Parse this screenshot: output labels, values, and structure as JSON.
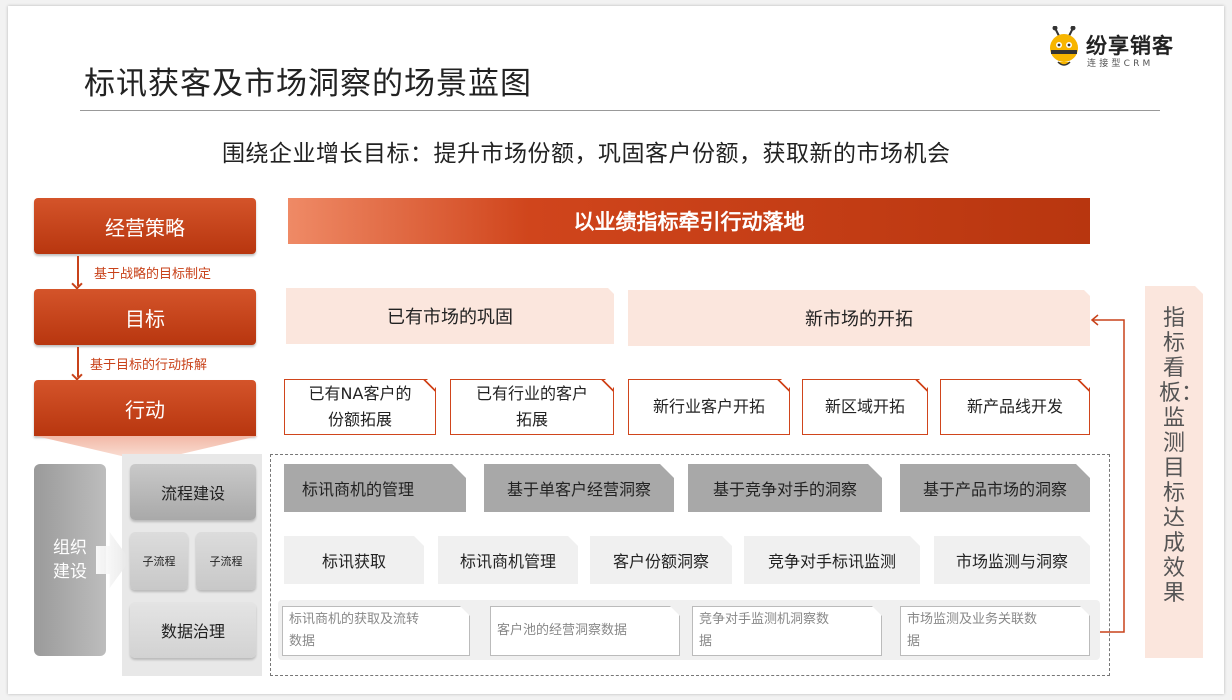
{
  "header": {
    "title": "标讯获客及市场洞察的场景蓝图",
    "subtitle": "围绕企业增长目标：提升市场份额，巩固客户份额，获取新的市场机会"
  },
  "logo": {
    "name": "纷享销客",
    "sub": "连接型CRM"
  },
  "left_column": {
    "strategy": "经营策略",
    "arrow1": "基于战略的目标制定",
    "goal": "目标",
    "arrow2": "基于目标的行动拆解",
    "action": "行动"
  },
  "banner": "以业绩指标牵引行动落地",
  "goals": [
    "已有市场的巩固",
    "新市场的开拓"
  ],
  "actions": [
    {
      "line1": "已有NA客户的",
      "line2": "份额拓展"
    },
    {
      "line1": "已有行业的客户",
      "line2": "拓展"
    },
    {
      "line1": "新行业客户开拓",
      "line2": ""
    },
    {
      "line1": "新区域开拓",
      "line2": ""
    },
    {
      "line1": "新产品线开发",
      "line2": ""
    }
  ],
  "org": {
    "label": "组织建设",
    "line1": "组织",
    "line2": "建设",
    "process": "流程建设",
    "sub1": "子流程",
    "sub2": "子流程",
    "data_gov": "数据治理"
  },
  "insights": [
    "标讯商机的管理",
    "基于单客户经营洞察",
    "基于竞争对手的洞察",
    "基于产品市场的洞察"
  ],
  "scenarios": [
    "标讯获取",
    "标讯商机管理",
    "客户份额洞察",
    "竞争对手标讯监测",
    "市场监测与洞察"
  ],
  "data_items": [
    {
      "line1": "标讯商机的获取及流转",
      "line2": "数据"
    },
    {
      "line1": "客户池的经营洞察数据",
      "line2": ""
    },
    {
      "line1": "竞争对手监测机洞察数",
      "line2": "据"
    },
    {
      "line1": "市场监测及业务关联数",
      "line2": "据"
    }
  ],
  "side_panel": "指标看板：监测目标达成效果",
  "colors": {
    "accent": "#c8421a",
    "pink": "#fbe6dd",
    "grey": "#a8a8a8"
  }
}
